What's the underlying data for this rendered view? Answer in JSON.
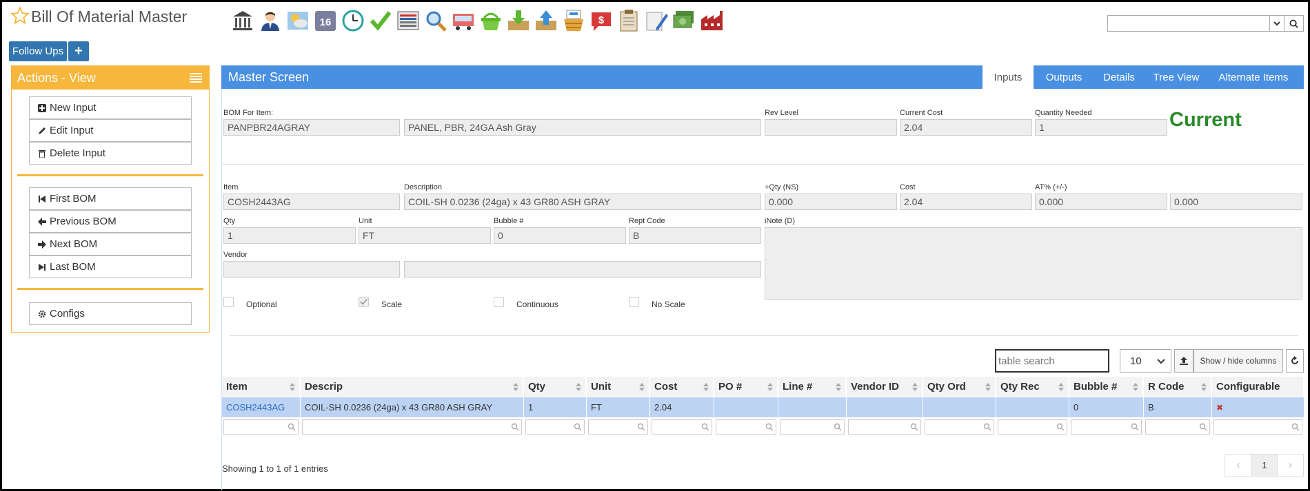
{
  "header": {
    "title": "Bill Of Material Master",
    "icons": [
      "bank-icon",
      "user-icon",
      "weather-icon",
      "calendar-icon",
      "clock-icon",
      "check-icon",
      "keyboard-icon",
      "magnifier-icon",
      "truck-icon",
      "basket-icon",
      "inbox-download-icon",
      "outbox-upload-icon",
      "tray-stack-icon",
      "dollar-chat-icon",
      "clipboard-icon",
      "pencil-note-icon",
      "cash-icon",
      "factory-icon"
    ],
    "calendar_day": "16",
    "follow_ups_label": "Follow Ups",
    "add_label": "+"
  },
  "sidebar": {
    "title": "Actions - View",
    "group1": [
      "New Input",
      "Edit Input",
      "Delete Input"
    ],
    "group2": [
      "First BOM",
      "Previous BOM",
      "Next BOM",
      "Last BOM"
    ],
    "group3": [
      "Configs"
    ]
  },
  "main": {
    "title": "Master Screen",
    "tabs": [
      "Inputs",
      "Outputs",
      "Details",
      "Tree View",
      "Alternate Items"
    ],
    "active_tab": "Inputs",
    "bom": {
      "bom_for_item_label": "BOM For Item:",
      "bom_for_item": "PANPBR24AGRAY",
      "bom_description": "PANEL, PBR, 24GA Ash Gray",
      "rev_level_label": "Rev Level",
      "rev_level": "",
      "current_cost_label": "Current Cost",
      "current_cost": "2.04",
      "qty_needed_label": "Quantity Needed",
      "qty_needed": "1",
      "status": "Current"
    },
    "input": {
      "item_label": "Item",
      "item": "COSH2443AG",
      "description_label": "Description",
      "description": "COIL-SH 0.0236 (24ga) x 43 GR80 ASH GRAY",
      "plus_qty_label": "+Qty (NS)",
      "plus_qty": "0.000",
      "cost_label": "Cost",
      "cost": "2.04",
      "at_label": "AT% (+/-)",
      "at_pct": "0.000",
      "at_extra": "0.000",
      "qty_label": "Qty",
      "qty": "1",
      "unit_label": "Unit",
      "unit": "FT",
      "bubble_label": "Bubble #",
      "bubble": "0",
      "rept_label": "Rept Code",
      "rept": "B",
      "inote_label": "iNote (D)",
      "vendor_label": "Vendor",
      "vendor": "",
      "vendor_name": "",
      "checkboxes": [
        {
          "label": "Optional",
          "checked": false
        },
        {
          "label": "Scale",
          "checked": true
        },
        {
          "label": "Continuous",
          "checked": false
        },
        {
          "label": "No Scale",
          "checked": false
        }
      ]
    },
    "table": {
      "search_placeholder": "table search",
      "page_size": "10",
      "show_hide_label": "Show / hide columns",
      "columns": [
        "Item",
        "Descrip",
        "Qty",
        "Unit",
        "Cost",
        "PO #",
        "Line #",
        "Vendor ID",
        "Qty Ord",
        "Qty Rec",
        "Bubble #",
        "R Code",
        "Configurable"
      ],
      "rows": [
        [
          "COSH2443AG",
          "COIL-SH 0.0236 (24ga) x 43 GR80 ASH GRAY",
          "1",
          "FT",
          "2.04",
          "",
          "",
          "",
          "",
          "",
          "0",
          "B",
          "✖"
        ]
      ],
      "showing": "Showing 1 to 1 of 1 entries",
      "pager_prev": "‹",
      "pager_current": "1",
      "pager_next": "›"
    }
  }
}
